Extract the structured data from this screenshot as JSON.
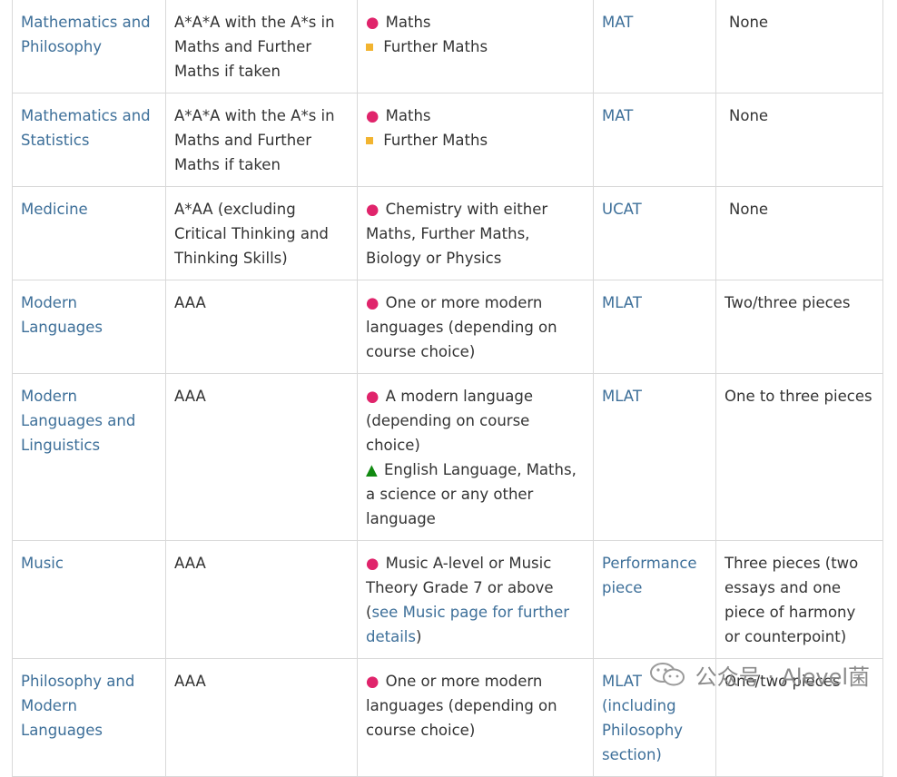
{
  "rows": [
    {
      "course": "Mathematics and Philosophy",
      "grades": "A*A*A with the A*s in Maths and Further Maths if taken",
      "subjects": [
        {
          "marker": "dot",
          "text": "Maths"
        },
        {
          "marker": "square",
          "text": "Further Maths"
        }
      ],
      "test": "MAT",
      "written": "None"
    },
    {
      "course": "Mathematics and Statistics",
      "grades": "A*A*A with the A*s in Maths and Further Maths if taken",
      "subjects": [
        {
          "marker": "dot",
          "text": "Maths"
        },
        {
          "marker": "square",
          "text": "Further Maths"
        }
      ],
      "test": "MAT",
      "written": "None"
    },
    {
      "course": "Medicine",
      "grades": "A*AA (excluding Critical Thinking and Thinking Skills)",
      "subjects": [
        {
          "marker": "dot",
          "text": "Chemistry with either Maths, Further Maths, Biology or Physics"
        }
      ],
      "test": "UCAT",
      "written": "None"
    },
    {
      "course": "Modern Languages",
      "grades": "AAA",
      "subjects": [
        {
          "marker": "dot",
          "text": "One or more modern languages (depending on course choice)"
        }
      ],
      "test": "MLAT",
      "written": "Two/three pieces"
    },
    {
      "course": "Modern Languages and Linguistics",
      "grades": "AAA",
      "subjects": [
        {
          "marker": "dot",
          "text": "A modern language (depending on course choice)"
        },
        {
          "marker": "triangle",
          "text": "English Language, Maths, a science or any other language"
        }
      ],
      "test": "MLAT",
      "written": "One to three pieces"
    },
    {
      "course": "Music",
      "grades": "AAA",
      "subjects": [
        {
          "marker": "dot",
          "text": "Music A-level or Music Theory Grade 7 or above (",
          "link": "see Music page for further details",
          "after": ")"
        }
      ],
      "test": "Performance piece",
      "written": "Three pieces (two essays and one piece of harmony or counterpoint)"
    },
    {
      "course": "Philosophy and Modern Languages",
      "grades": "AAA",
      "subjects": [
        {
          "marker": "dot",
          "text": "One or more modern languages (depending on course choice)"
        }
      ],
      "test": "MLAT (including Philosophy section)",
      "written": "One/two pieces"
    }
  ],
  "markers": {
    "dot": "●",
    "triangle": "▲"
  },
  "colors": {
    "link": "#3d6f99",
    "dot": "#e0246b",
    "square": "#f2b430",
    "triangle": "#118a11",
    "border": "#d9d9d9"
  },
  "watermark": {
    "text": "公众号 · Alevel菌",
    "icon": "wechat-icon"
  }
}
